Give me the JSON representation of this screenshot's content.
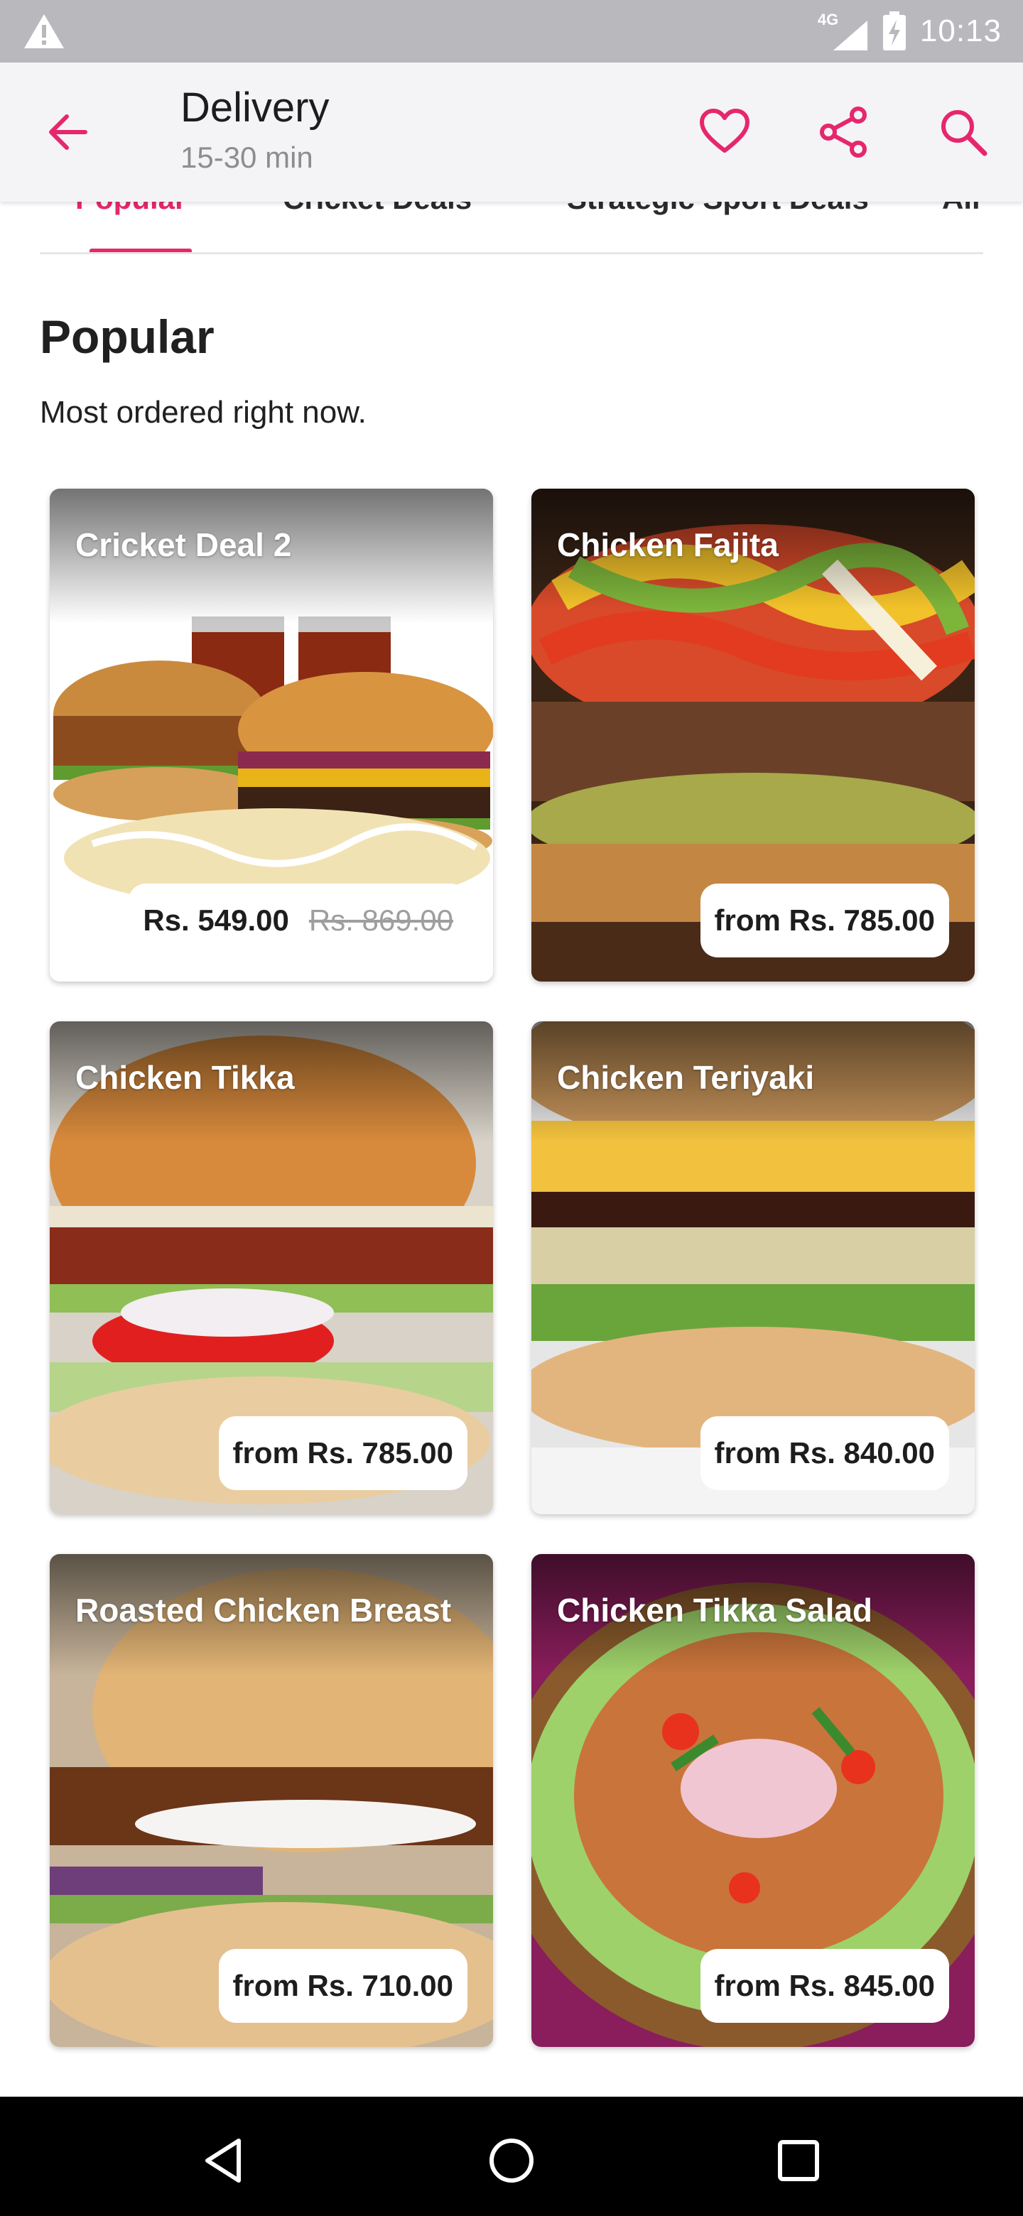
{
  "status_bar": {
    "time": "10:13",
    "network": "4G",
    "icons": [
      "warning-icon",
      "signal-icon",
      "battery-charging-icon"
    ]
  },
  "app_bar": {
    "title": "Delivery",
    "subtitle": "15-30 min",
    "icons": [
      "back-arrow-icon",
      "heart-icon",
      "share-icon",
      "search-icon"
    ],
    "accent": "#e6276c"
  },
  "tabs": [
    {
      "label": "Popular",
      "active": true
    },
    {
      "label": "Cricket Deals"
    },
    {
      "label": "Strategic Sport Deals"
    },
    {
      "label": "All"
    }
  ],
  "section": {
    "title": "Popular",
    "subtitle": "Most ordered right now."
  },
  "items": [
    {
      "name": "Cricket Deal 2",
      "price": "Rs. 549.00",
      "old_price": "Rs. 869.00"
    },
    {
      "name": "Chicken Fajita",
      "price": "from Rs. 785.00"
    },
    {
      "name": "Chicken Tikka",
      "price": "from Rs. 785.00"
    },
    {
      "name": "Chicken Teriyaki",
      "price": "from Rs. 840.00"
    },
    {
      "name": "Roasted Chicken Breast",
      "price": "from Rs. 710.00"
    },
    {
      "name": "Chicken Tikka Salad",
      "price": "from Rs. 845.00"
    }
  ],
  "nav_bar": {
    "icons": [
      "back-triangle-icon",
      "home-circle-icon",
      "recents-square-icon"
    ]
  }
}
